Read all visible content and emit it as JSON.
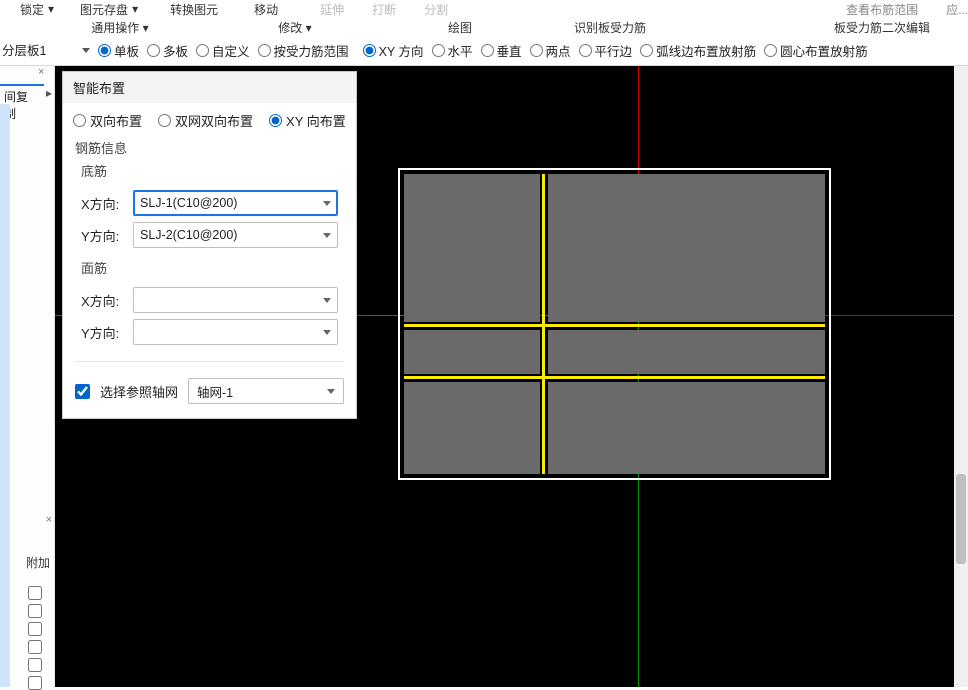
{
  "ribbon": {
    "frag1": "锁定",
    "frag2": "图元存盘",
    "frag3": "转换图元",
    "frag4": "移动",
    "frag5": "延伸",
    "frag6": "打断",
    "frag7": "分割",
    "group_ops": "通用操作",
    "group_ops_dd": "▾",
    "group_modify": "修改",
    "group_modify_dd": "▾",
    "group_draw": "绘图",
    "group_detect": "识别板受力筋",
    "group_chk": "查看布筋范围",
    "group_rightlbl": "板受力筋二次编辑",
    "group_apply": "应..."
  },
  "toolbar2": {
    "layer_value": "分层板1",
    "radios_a": [
      "单板",
      "多板",
      "自定义",
      "按受力筋范围"
    ],
    "radios_a_selected": 0,
    "radios_b": [
      "XY 方向",
      "水平",
      "垂直",
      "两点",
      "平行边",
      "弧线边布置放射筋",
      "圆心布置放射筋"
    ],
    "radios_b_selected": 0
  },
  "sidebar": {
    "tab_label": "间复制",
    "more": "▸",
    "attach": "附加"
  },
  "panel": {
    "title": "智能布置",
    "mode_radios": [
      "双向布置",
      "双网双向布置",
      "XY 向布置"
    ],
    "mode_selected": 2,
    "rebar_info_label": "钢筋信息",
    "bottom_label": "底筋",
    "x_label": "X方向:",
    "y_label": "Y方向:",
    "x_bottom_value": "SLJ-1(C10@200)",
    "y_bottom_value": "SLJ-2(C10@200)",
    "top_label": "面筋",
    "x_top_value": "",
    "y_top_value": "",
    "ref_axis_checked": true,
    "ref_axis_label": "选择参照轴网",
    "axis_value": "轴网-1"
  }
}
